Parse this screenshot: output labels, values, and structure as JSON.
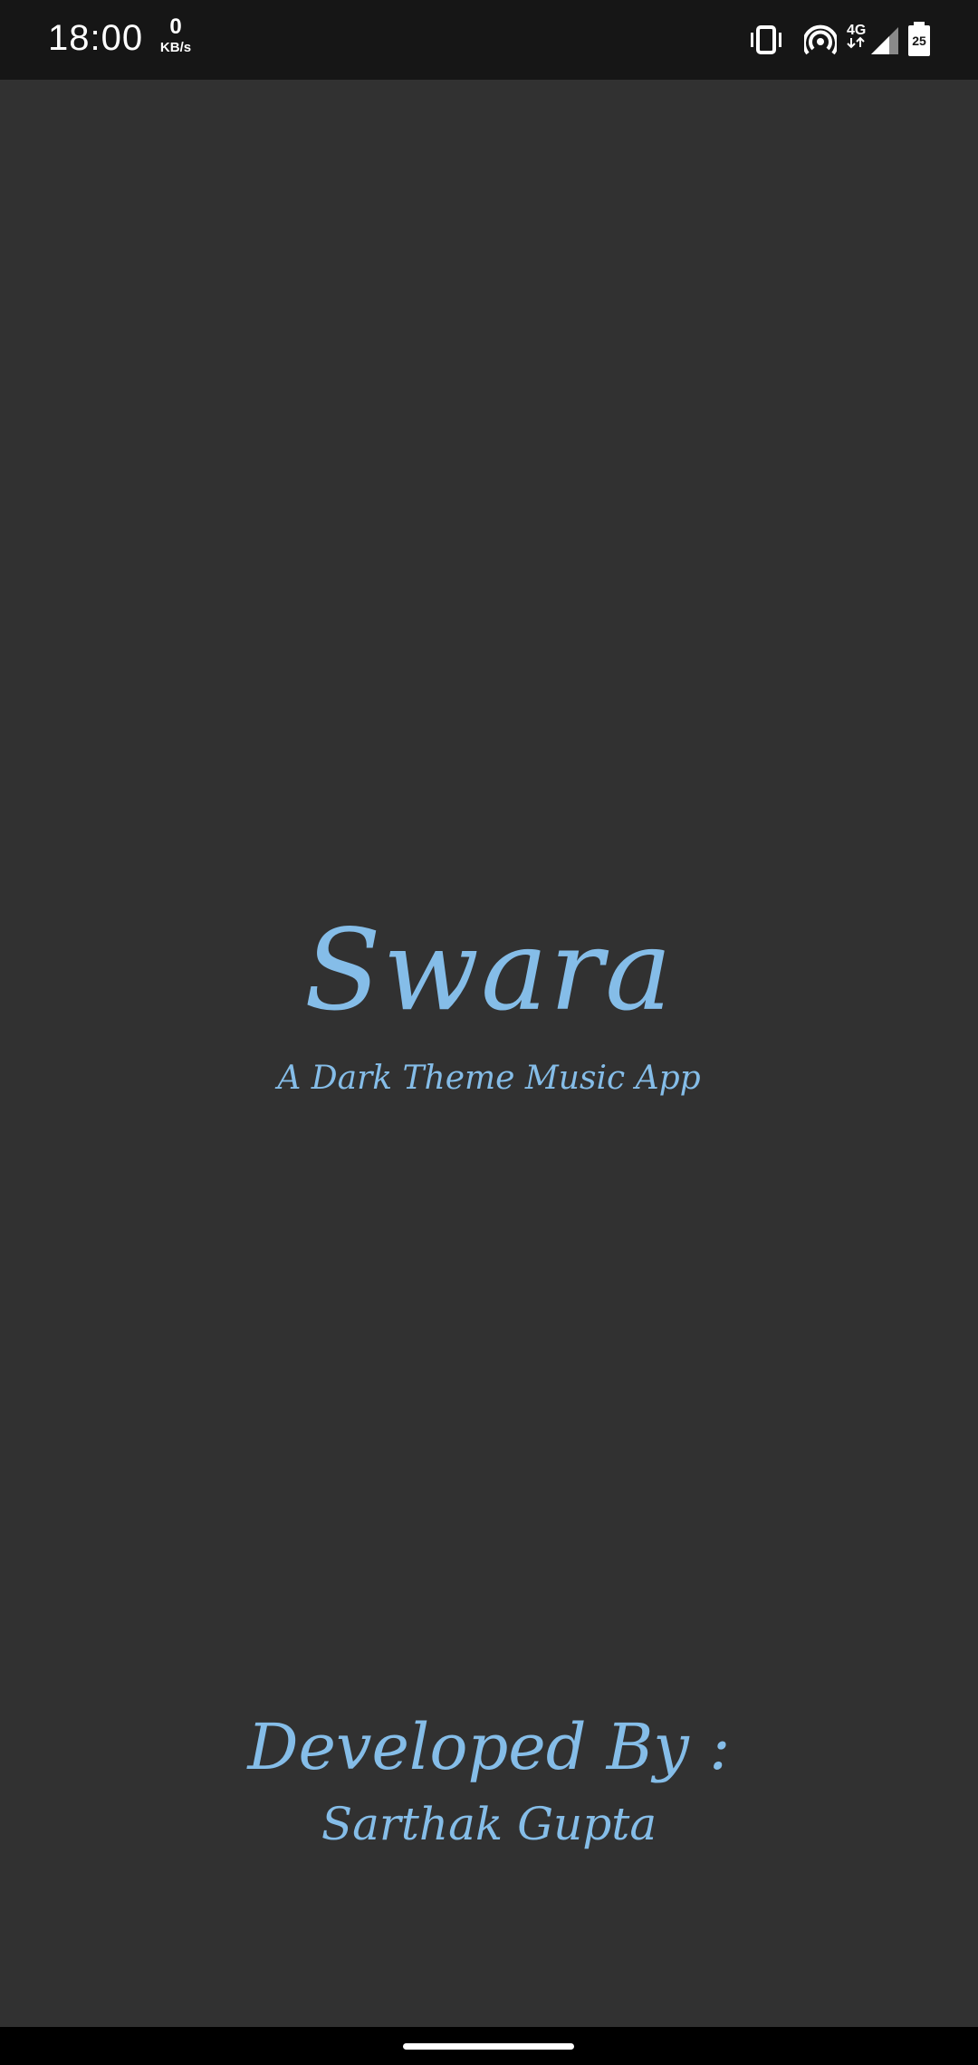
{
  "status_bar": {
    "time": "18:00",
    "net_speed_value": "0",
    "net_speed_unit": "KB/s",
    "network_type": "4G",
    "battery_level": "25",
    "icons": [
      "vibrate-icon",
      "hotspot-icon",
      "network-4g-icon",
      "signal-icon",
      "battery-icon"
    ]
  },
  "splash": {
    "title": "Swara",
    "tagline": "A Dark Theme Music App",
    "developer_label": "Developed By :",
    "developer_name": "Sarthak Gupta"
  },
  "colors": {
    "background": "#313131",
    "status_bar": "#161616",
    "accent": "#85bde8",
    "nav_bar": "#000000"
  }
}
